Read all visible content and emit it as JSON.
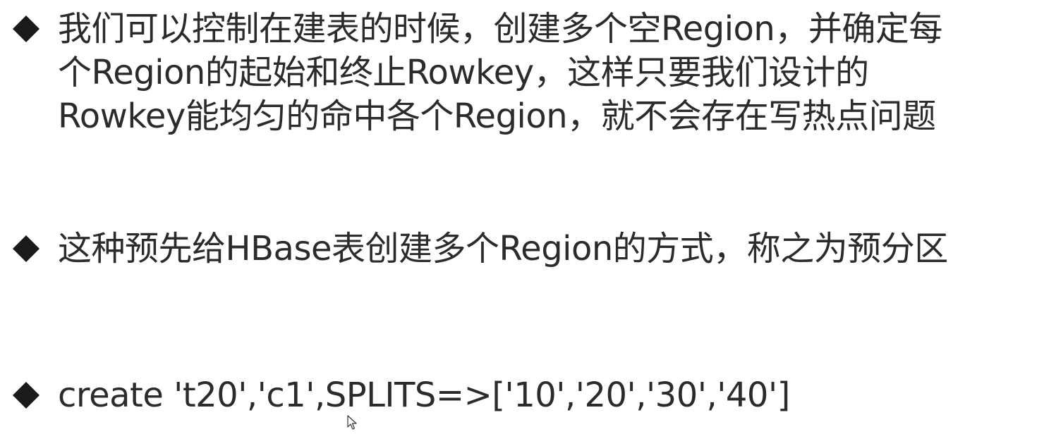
{
  "bullets": [
    {
      "lines": [
        "我们可以控制在建表的时候，创建多个空Region，并确定每",
        "个Region的起始和终止Rowkey，这样只要我们设计的",
        "Rowkey能均匀的命中各个Region，就不会存在写热点问题"
      ]
    },
    {
      "lines": [
        "这种预先给HBase表创建多个Region的方式，称之为预分区"
      ]
    },
    {
      "lines": [
        "create 't20','c1',SPLITS=>['10','20','30','40']"
      ]
    }
  ],
  "icons": {
    "bullet": "diamond-bullet-icon",
    "cursor": "mouse-pointer-icon"
  },
  "colors": {
    "text": "#2b2b2b",
    "bullet": "#1a1a1a",
    "background": "#ffffff"
  }
}
